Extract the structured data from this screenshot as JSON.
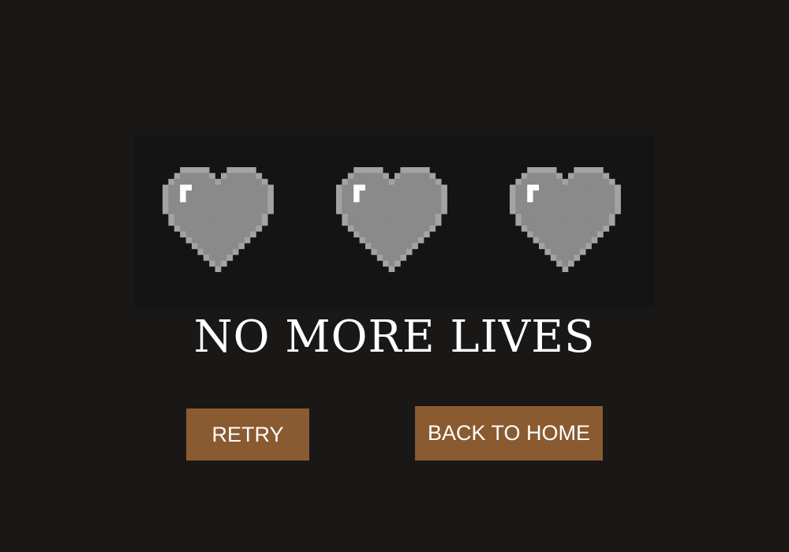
{
  "screen": {
    "title": "NO MORE LIVES",
    "background_color": "#1a1717"
  },
  "lives": {
    "total": 3,
    "remaining": 0,
    "hearts": [
      {
        "icon": "empty-heart-icon",
        "state": "empty"
      },
      {
        "icon": "empty-heart-icon",
        "state": "empty"
      },
      {
        "icon": "empty-heart-icon",
        "state": "empty"
      }
    ],
    "heart_color": "#8a8a8a",
    "heart_edge_color": "#a3a3a3",
    "heart_shine_color": "#ffffff"
  },
  "buttons": {
    "retry_label": "RETRY",
    "home_label": "BACK TO HOME",
    "color": "#8a5a30"
  }
}
